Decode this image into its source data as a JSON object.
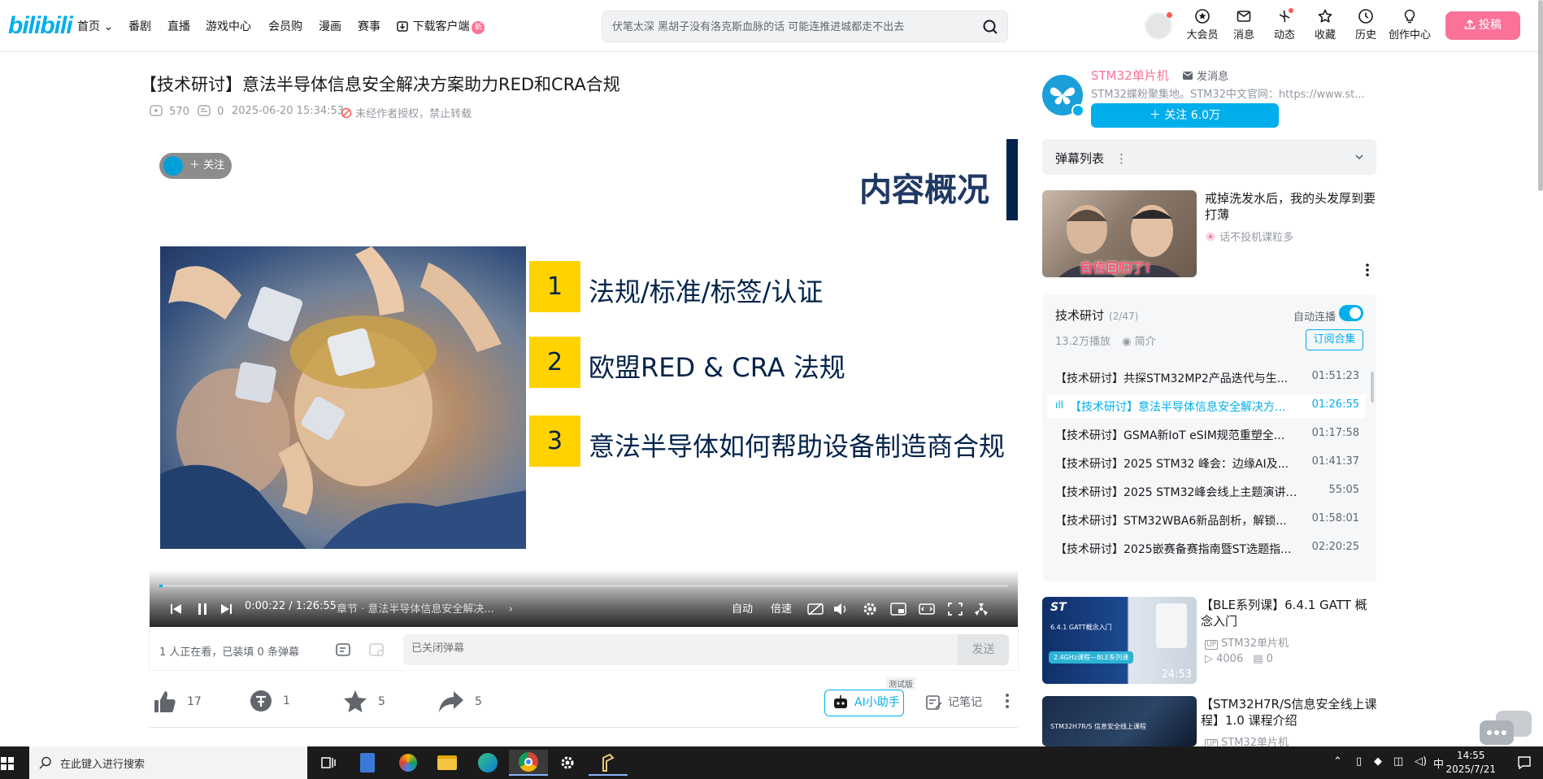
{
  "header": {
    "logo": "bilibili",
    "nav": [
      {
        "label": "首页",
        "caret": true
      },
      {
        "label": "番剧"
      },
      {
        "label": "直播"
      },
      {
        "label": "游戏中心"
      },
      {
        "label": "会员购"
      },
      {
        "label": "漫画"
      },
      {
        "label": "赛事"
      },
      {
        "label": "下载客户端",
        "badge": "新"
      }
    ],
    "search_placeholder": "伏笔太深 黑胡子没有洛克斯血脉的话 可能连推进城都走不出去",
    "icons": [
      {
        "label": "大会员",
        "icon": "vip-icon"
      },
      {
        "label": "消息",
        "icon": "message-icon"
      },
      {
        "label": "动态",
        "icon": "dynamic-icon"
      },
      {
        "label": "收藏",
        "icon": "favorite-icon"
      },
      {
        "label": "历史",
        "icon": "history-icon"
      },
      {
        "label": "创作中心",
        "icon": "creator-icon"
      }
    ],
    "upload": "投稿"
  },
  "video": {
    "title": "【技术研讨】意法半导体信息安全解决方案助力RED和CRA合规",
    "views": "570",
    "danmaku_count": "0",
    "date": "2025-06-20 15:34:53",
    "copyright": "未经作者授权，禁止转载"
  },
  "slide": {
    "heading": "内容概况",
    "items": [
      {
        "num": "1",
        "text": "法规/标准/标签/认证"
      },
      {
        "num": "2",
        "text": "欧盟RED & CRA 法规"
      },
      {
        "num": "3",
        "text": "意法半导体如何帮助设备制造商合规"
      }
    ],
    "follow_label": "＋ 关注"
  },
  "player": {
    "current_time": "0:00:22",
    "separator": "/",
    "total_time": "1:26:55",
    "progress": 0.004,
    "chapter": "章节 · 意法半导体信息安全解决...",
    "quality": "自动",
    "speed": "倍速"
  },
  "danmaku_bar": {
    "status": "1 人正在看，已装填 0 条弹幕",
    "placeholder": "已关闭弹幕",
    "send": "发送"
  },
  "actions": {
    "like": "17",
    "coin": "1",
    "favorite": "5",
    "share": "5",
    "ai_label": "AI小助手",
    "ai_tag": "测试版",
    "notes": "记笔记"
  },
  "uploader": {
    "name": "STM32单片机",
    "message": "发消息",
    "desc": "STM32蝶粉聚集地。STM32中文官网：https://www.st...",
    "follow": "＋ 关注 6.0万"
  },
  "danmaku_list": {
    "title": "弹幕列表"
  },
  "recommend_top": {
    "title": "戒掉洗发水后，我的头发厚到要打薄",
    "author": "话不投机课粒多",
    "thumb_caption": "自信回归了!"
  },
  "collection": {
    "title": "技术研讨",
    "count": "(2/47)",
    "auto": "自动连播",
    "plays": "13.2万播放",
    "intro": "简介",
    "subscribe": "订阅合集",
    "episodes": [
      {
        "title": "【技术研讨】共探STM32MP2产品迭代与生...",
        "duration": "01:51:23",
        "active": false
      },
      {
        "title": "【技术研讨】意法半导体信息安全解决方...",
        "duration": "01:26:55",
        "active": true
      },
      {
        "title": "【技术研讨】GSMA新IoT eSIM规范重塑全...",
        "duration": "01:17:58",
        "active": false
      },
      {
        "title": "【技术研讨】2025 STM32 峰会：边缘AI及...",
        "duration": "01:41:37",
        "active": false
      },
      {
        "title": "【技术研讨】2025 STM32峰会线上主题演讲直...",
        "duration": "55:05",
        "active": false
      },
      {
        "title": "【技术研讨】STM32WBA6新品剖析，解锁...",
        "duration": "01:58:01",
        "active": false
      },
      {
        "title": "【技术研讨】2025嵌赛备赛指南暨ST选题指...",
        "duration": "02:20:25",
        "active": false
      }
    ]
  },
  "recommend": [
    {
      "title": "【BLE系列课】6.4.1 GATT 概念入门",
      "author": "STM32单片机",
      "views": "4006",
      "danmaku": "0",
      "duration": "24:53",
      "thumb_text": "6.4.1 GATT概念入门",
      "thumb_tag": "2.4GHz课程—BLE系列课"
    },
    {
      "title": "【STM32H7R/S信息安全线上课程】1.0 课程介绍",
      "author": "STM32单片机",
      "thumb_text": "STM32H7R/S 信息安全线上课程"
    }
  ],
  "taskbar": {
    "search": "在此键入进行搜索",
    "ime": "中",
    "time": "14:55",
    "date": "2025/7/21"
  },
  "colors": {
    "brand": "#00aeec",
    "pink": "#fb7299",
    "slide_yellow": "#ffd200",
    "slide_navy": "#03234b"
  }
}
